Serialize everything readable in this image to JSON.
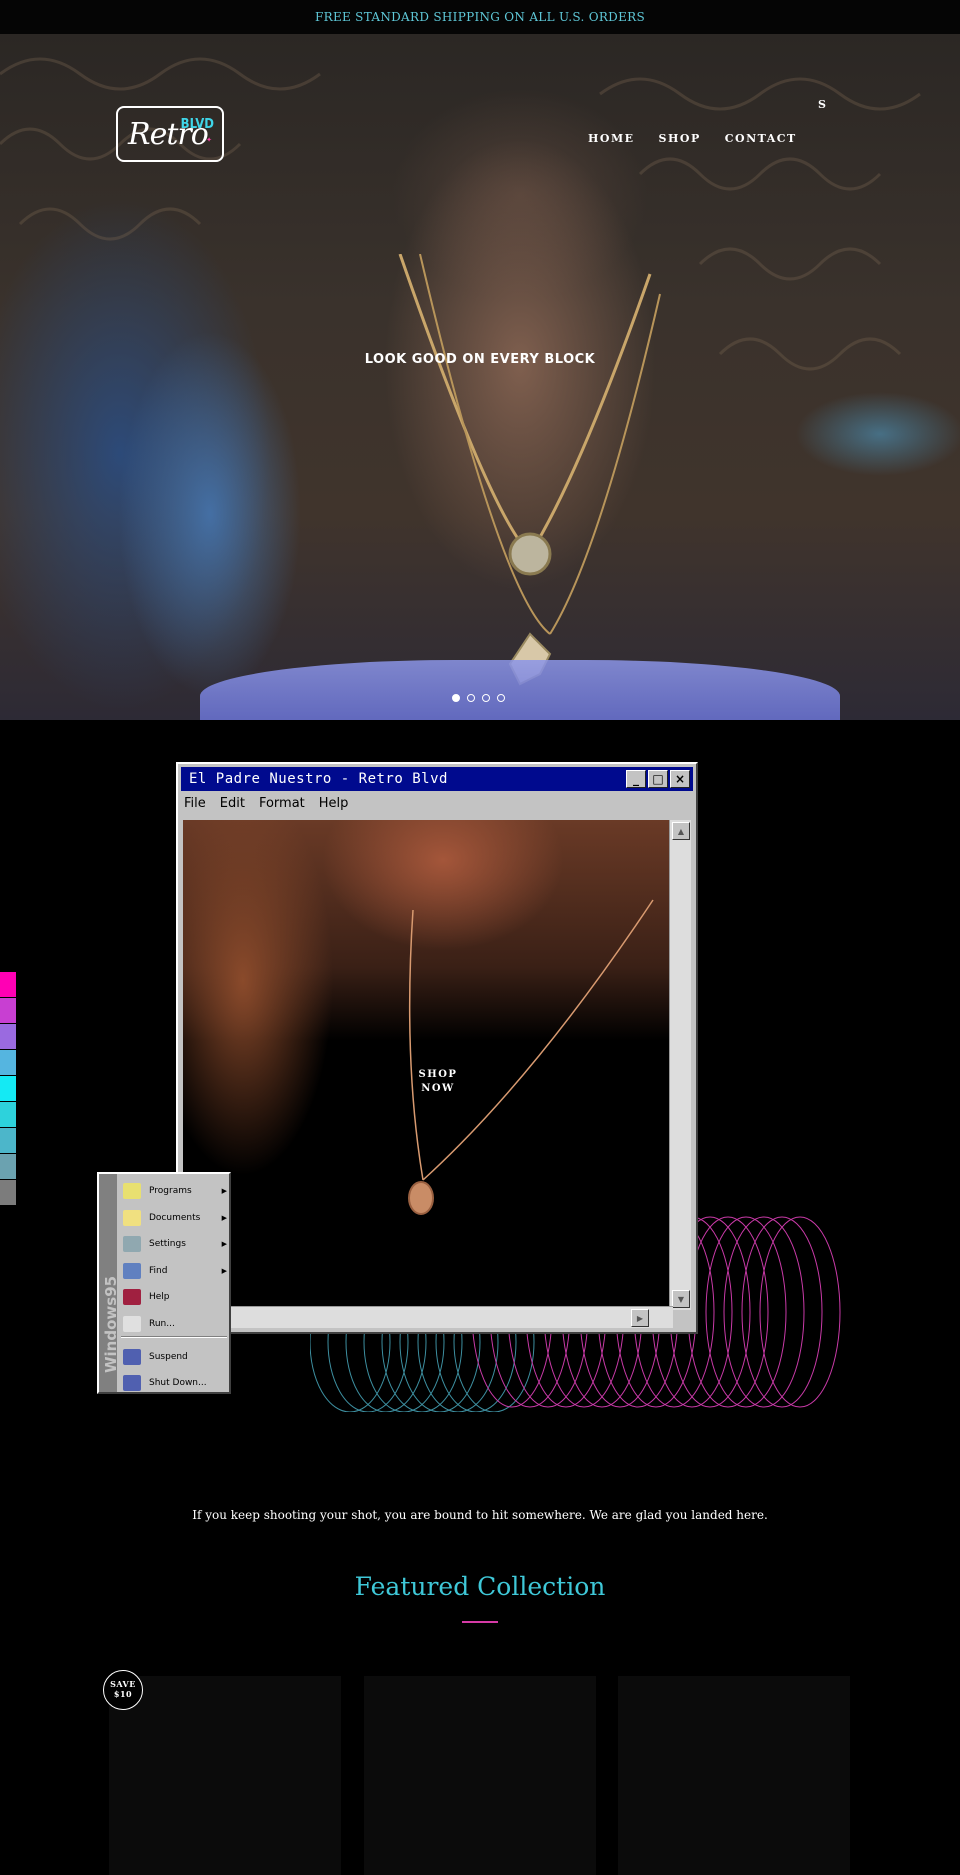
{
  "announcement": "FREE STANDARD SHIPPING ON ALL U.S. ORDERS",
  "logo": {
    "script": "Retro",
    "blvd": "BLVD",
    "accent": ""
  },
  "nav": {
    "items": [
      "HOME",
      "SHOP",
      "CONTACT"
    ],
    "search": "S"
  },
  "hero": {
    "heading": "LOOK GOOD ON EVERY BLOCK",
    "slides": 4,
    "active_slide": 1
  },
  "window": {
    "title": "El Padre Nuestro - Retro Blvd",
    "buttons": [
      "_",
      "□",
      "×"
    ],
    "menu": [
      "File",
      "Edit",
      "Format",
      "Help"
    ],
    "cta_line1": "SHOP",
    "cta_line2": "NOW"
  },
  "start_menu": {
    "brand": "Windows95",
    "items": [
      {
        "label": "Programs",
        "submenu": true,
        "icon": "programs-icon"
      },
      {
        "label": "Documents",
        "submenu": true,
        "icon": "folder-icon"
      },
      {
        "label": "Settings",
        "submenu": true,
        "icon": "settings-icon"
      },
      {
        "label": "Find",
        "submenu": true,
        "icon": "find-icon"
      },
      {
        "label": "Help",
        "submenu": false,
        "icon": "help-book-icon"
      },
      {
        "label": "Run...",
        "submenu": false,
        "icon": "run-icon"
      },
      {
        "label": "Suspend",
        "submenu": false,
        "icon": "suspend-icon"
      },
      {
        "label": "Shut Down...",
        "submenu": false,
        "icon": "shutdown-icon"
      }
    ]
  },
  "palette_colors": [
    "#ff00b4",
    "#c83fd2",
    "#9a6ae0",
    "#55b5e0",
    "#14eaf4",
    "#2dd2dc",
    "#4cb6ca",
    "#6ba2b0",
    "#7c7c7c"
  ],
  "tagline": "If you keep shooting your shot, you are bound to hit somewhere. We are glad you landed here.",
  "featured": {
    "title": "Featured Collection",
    "badge_line1": "SAVE",
    "badge_line2": "$10"
  },
  "colors": {
    "accent_cyan": "#3fc8d8",
    "accent_pink": "#d63aa6",
    "win_title": "#000a8e"
  }
}
